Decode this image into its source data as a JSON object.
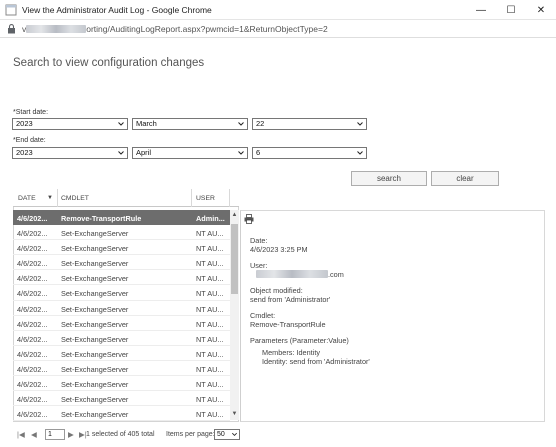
{
  "window": {
    "title": "View the Administrator Audit Log - Google Chrome",
    "controls": {
      "minimize": "—",
      "maximize": "☐",
      "close": "✕"
    }
  },
  "address_bar": {
    "url_prefix": "v",
    "url_suffix": "orting/AuditingLogReport.aspx?pwmcid=1&ReturnObjectType=2"
  },
  "page": {
    "heading": "Search to view configuration changes",
    "start_date": {
      "label": "*Start date:",
      "year": "2023",
      "month": "March",
      "day": "22"
    },
    "end_date": {
      "label": "*End date:",
      "year": "2023",
      "month": "April",
      "day": "6"
    },
    "buttons": {
      "search": "search",
      "clear": "clear"
    }
  },
  "grid": {
    "columns": [
      "DATE",
      "CMDLET",
      "USER"
    ],
    "sort_indicator": "▼",
    "rows": [
      {
        "date": "4/6/202...",
        "cmdlet": "Remove-TransportRule",
        "user": "Admin...",
        "selected": true
      },
      {
        "date": "4/6/202...",
        "cmdlet": "Set-ExchangeServer",
        "user": "NT AU..."
      },
      {
        "date": "4/6/202...",
        "cmdlet": "Set-ExchangeServer",
        "user": "NT AU..."
      },
      {
        "date": "4/6/202...",
        "cmdlet": "Set-ExchangeServer",
        "user": "NT AU..."
      },
      {
        "date": "4/6/202...",
        "cmdlet": "Set-ExchangeServer",
        "user": "NT AU..."
      },
      {
        "date": "4/6/202...",
        "cmdlet": "Set-ExchangeServer",
        "user": "NT AU..."
      },
      {
        "date": "4/6/202...",
        "cmdlet": "Set-ExchangeServer",
        "user": "NT AU..."
      },
      {
        "date": "4/6/202...",
        "cmdlet": "Set-ExchangeServer",
        "user": "NT AU..."
      },
      {
        "date": "4/6/202...",
        "cmdlet": "Set-ExchangeServer",
        "user": "NT AU..."
      },
      {
        "date": "4/6/202...",
        "cmdlet": "Set-ExchangeServer",
        "user": "NT AU..."
      },
      {
        "date": "4/6/202...",
        "cmdlet": "Set-ExchangeServer",
        "user": "NT AU..."
      },
      {
        "date": "4/6/202...",
        "cmdlet": "Set-ExchangeServer",
        "user": "NT AU..."
      },
      {
        "date": "4/6/202...",
        "cmdlet": "Set-ExchangeServer",
        "user": "NT AU..."
      },
      {
        "date": "4/6/202...",
        "cmdlet": "Set-ExchangeServer",
        "user": "NT AU..."
      }
    ]
  },
  "detail": {
    "date_label": "Date:",
    "date_value": "4/6/2023 3:25 PM",
    "user_label": "User:",
    "user_value_suffix": ".com",
    "object_label": "Object modified:",
    "object_value": "send from 'Administrator'",
    "cmdlet_label": "Cmdlet:",
    "cmdlet_value": "Remove-TransportRule",
    "params_label": "Parameters (Parameter:Value)",
    "param_1": "Members: Identity",
    "param_2": "Identity: send from 'Administrator'"
  },
  "pager": {
    "first": "|◀",
    "prev": "◀",
    "page": "1",
    "next": "▶",
    "last": "▶|",
    "selection_text": "1 selected of 405 total",
    "items_per_page_label": "Items per page:",
    "items_per_page_value": "50"
  },
  "colors": {
    "selected_row": "#6d6d6d",
    "border": "#d4d4d4",
    "text": "#333333"
  }
}
